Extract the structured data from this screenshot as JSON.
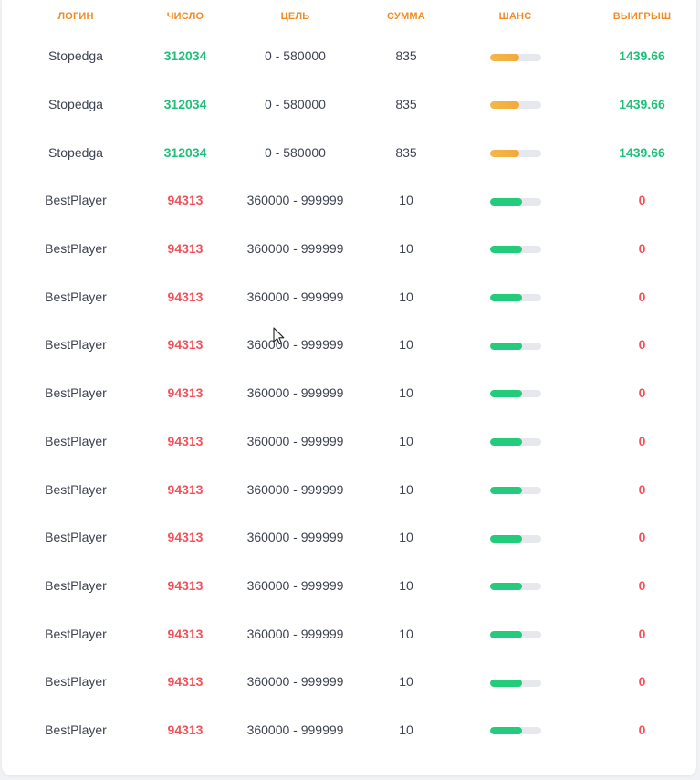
{
  "header": {
    "color": "#f28b24",
    "columns": [
      {
        "label": "ЛОГИН"
      },
      {
        "label": "ЧИСЛО"
      },
      {
        "label": "ЦЕЛЬ"
      },
      {
        "label": "СУММА"
      },
      {
        "label": "ШАНС"
      },
      {
        "label": "ВЫИГРЫШ"
      }
    ]
  },
  "colors": {
    "win": "#1ec07a",
    "lose": "#f4525a",
    "chance_win": "#f2a93b",
    "chance_lose": "#22cc7a",
    "bar_track": "#e6e8ee"
  },
  "rows": [
    {
      "login": "Stopedga",
      "number": "312034",
      "target": "0 - 580000",
      "amount": "835",
      "chance_pct": 58,
      "payout": "1439.66",
      "result": "win"
    },
    {
      "login": "Stopedga",
      "number": "312034",
      "target": "0 - 580000",
      "amount": "835",
      "chance_pct": 58,
      "payout": "1439.66",
      "result": "win"
    },
    {
      "login": "Stopedga",
      "number": "312034",
      "target": "0 - 580000",
      "amount": "835",
      "chance_pct": 58,
      "payout": "1439.66",
      "result": "win"
    },
    {
      "login": "BestPlayer",
      "number": "94313",
      "target": "360000 - 999999",
      "amount": "10",
      "chance_pct": 64,
      "payout": "0",
      "result": "lose"
    },
    {
      "login": "BestPlayer",
      "number": "94313",
      "target": "360000 - 999999",
      "amount": "10",
      "chance_pct": 64,
      "payout": "0",
      "result": "lose"
    },
    {
      "login": "BestPlayer",
      "number": "94313",
      "target": "360000 - 999999",
      "amount": "10",
      "chance_pct": 64,
      "payout": "0",
      "result": "lose"
    },
    {
      "login": "BestPlayer",
      "number": "94313",
      "target": "360000 - 999999",
      "amount": "10",
      "chance_pct": 64,
      "payout": "0",
      "result": "lose"
    },
    {
      "login": "BestPlayer",
      "number": "94313",
      "target": "360000 - 999999",
      "amount": "10",
      "chance_pct": 64,
      "payout": "0",
      "result": "lose"
    },
    {
      "login": "BestPlayer",
      "number": "94313",
      "target": "360000 - 999999",
      "amount": "10",
      "chance_pct": 64,
      "payout": "0",
      "result": "lose"
    },
    {
      "login": "BestPlayer",
      "number": "94313",
      "target": "360000 - 999999",
      "amount": "10",
      "chance_pct": 64,
      "payout": "0",
      "result": "lose"
    },
    {
      "login": "BestPlayer",
      "number": "94313",
      "target": "360000 - 999999",
      "amount": "10",
      "chance_pct": 64,
      "payout": "0",
      "result": "lose"
    },
    {
      "login": "BestPlayer",
      "number": "94313",
      "target": "360000 - 999999",
      "amount": "10",
      "chance_pct": 64,
      "payout": "0",
      "result": "lose"
    },
    {
      "login": "BestPlayer",
      "number": "94313",
      "target": "360000 - 999999",
      "amount": "10",
      "chance_pct": 64,
      "payout": "0",
      "result": "lose"
    },
    {
      "login": "BestPlayer",
      "number": "94313",
      "target": "360000 - 999999",
      "amount": "10",
      "chance_pct": 64,
      "payout": "0",
      "result": "lose"
    },
    {
      "login": "BestPlayer",
      "number": "94313",
      "target": "360000 - 999999",
      "amount": "10",
      "chance_pct": 64,
      "payout": "0",
      "result": "lose"
    }
  ]
}
